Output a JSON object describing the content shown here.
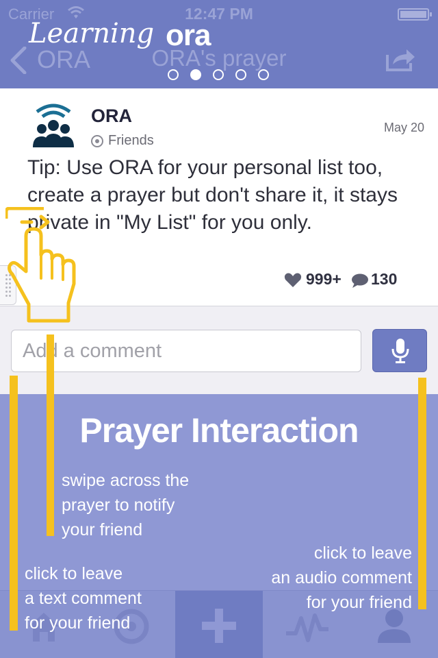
{
  "status_bar": {
    "carrier": "Carrier",
    "time": "12:47 PM"
  },
  "brand": {
    "script": "Learning",
    "bold": "ora"
  },
  "nav": {
    "back_label": "ORA",
    "title": "ORA's prayer",
    "page_count": 5,
    "active_page": 2
  },
  "post": {
    "author": "ORA",
    "audience": "Friends",
    "date": "May 20",
    "body": "Tip: Use ORA for your personal list too, create a prayer but don't share it, it stays private in \"My List\" for you only.",
    "likes": "999+",
    "comments": "130"
  },
  "comment_box": {
    "placeholder": "Add a comment"
  },
  "tutorial": {
    "title": "Prayer Interaction",
    "swipe_note": "swipe across the\nprayer to notify\nyour friend",
    "text_note": "click to leave\na text comment\nfor your friend",
    "audio_note": "click to leave\nan audio comment\nfor your friend"
  },
  "tabbar": {
    "items": [
      "home-icon",
      "target-icon",
      "plus-icon",
      "activity-icon",
      "profile-icon"
    ],
    "active_index": 2
  },
  "colors": {
    "brand": "#6f7cc2",
    "overlay": "#8f98d4",
    "guide": "#f5c11e"
  }
}
